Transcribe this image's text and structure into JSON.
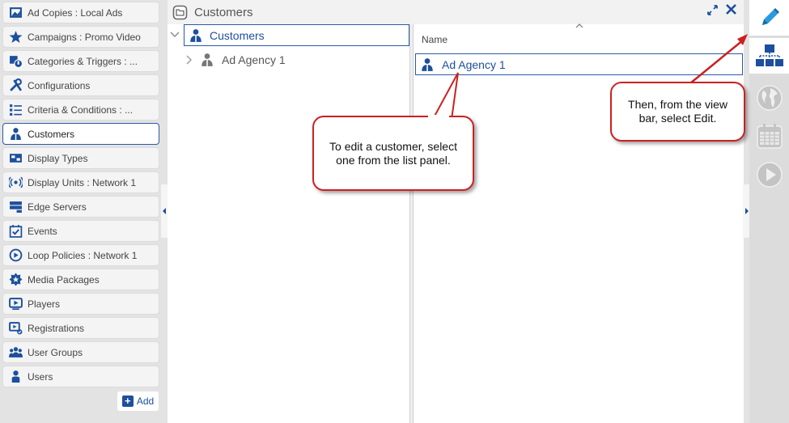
{
  "sidebar": {
    "items": [
      {
        "label": "Ad Copies : Local Ads",
        "icon": "image-icon"
      },
      {
        "label": "Campaigns : Promo Video",
        "icon": "star-icon"
      },
      {
        "label": "Categories & Triggers : ...",
        "icon": "tag-icon"
      },
      {
        "label": "Configurations",
        "icon": "tools-icon"
      },
      {
        "label": "Criteria & Conditions : ...",
        "icon": "checklist-icon"
      },
      {
        "label": "Customers",
        "icon": "customer-icon",
        "active": true
      },
      {
        "label": "Display Types",
        "icon": "display-types-icon"
      },
      {
        "label": "Display Units : Network 1",
        "icon": "broadcast-icon"
      },
      {
        "label": "Edge Servers",
        "icon": "server-icon"
      },
      {
        "label": "Events",
        "icon": "calendar-check-icon"
      },
      {
        "label": "Loop Policies : Network 1",
        "icon": "loop-icon"
      },
      {
        "label": "Media Packages",
        "icon": "package-icon"
      },
      {
        "label": "Players",
        "icon": "player-icon"
      },
      {
        "label": "Registrations",
        "icon": "registration-icon"
      },
      {
        "label": "User Groups",
        "icon": "user-group-icon"
      },
      {
        "label": "Users",
        "icon": "user-icon"
      }
    ],
    "add_label": "Add"
  },
  "main": {
    "title": "Customers",
    "tree": {
      "root_label": "Customers",
      "child_label": "Ad Agency 1"
    },
    "list": {
      "column_header": "Name",
      "rows": [
        "Ad Agency 1"
      ]
    }
  },
  "callouts": {
    "list_panel": "To edit a customer, select one from the list panel.",
    "view_bar": "Then, from the view bar, select Edit."
  },
  "colors": {
    "accent": "#1c4f9c",
    "callout_border": "#cc2020",
    "selection_border": "#2b5aa8"
  }
}
